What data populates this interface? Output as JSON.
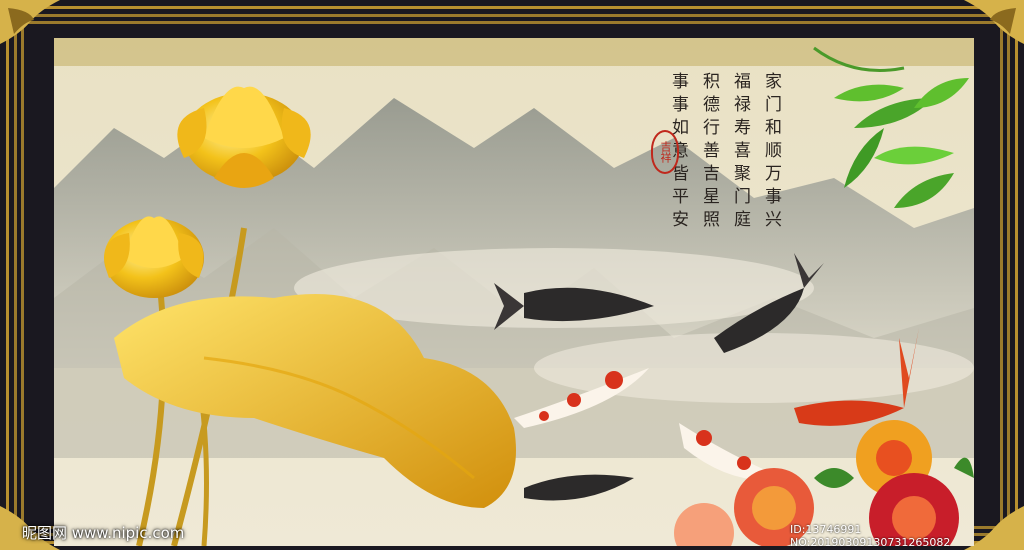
{
  "poem": {
    "col1": "家门和顺万事兴",
    "col2": "福禄寿喜聚门庭",
    "col3": "积德行善吉星照",
    "col4": "事事如意皆平安"
  },
  "seal_text": "吉祥",
  "watermark": {
    "site": "昵图网 www.nipic.com",
    "id": "ID:13746991 NO:20190309130731265082"
  },
  "colors": {
    "frame": "#1a1820",
    "gold": "#c9a23a",
    "lotus": "#f2c21a",
    "sky": "#ebe4cf"
  }
}
